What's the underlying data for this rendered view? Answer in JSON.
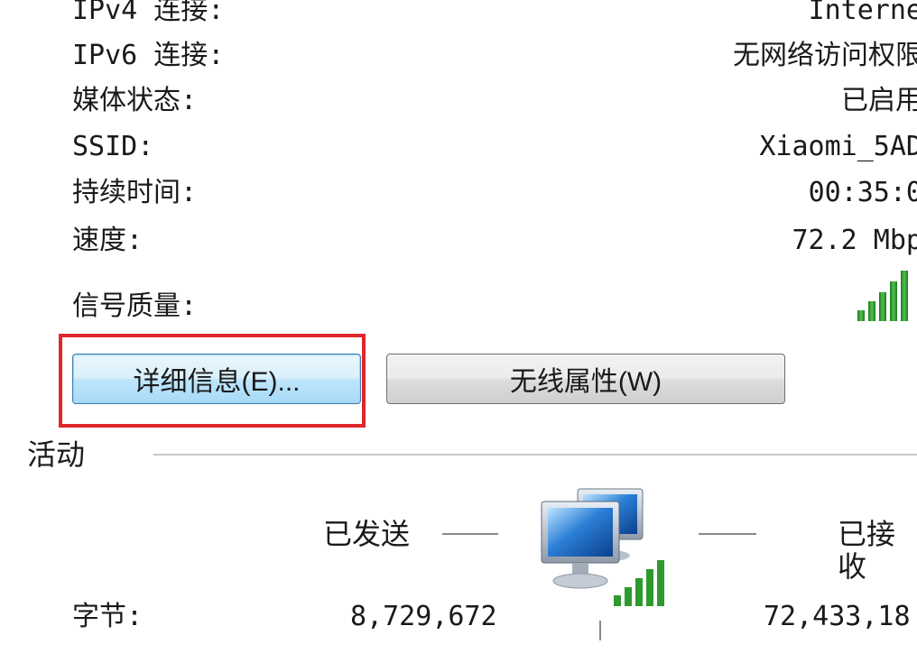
{
  "connection": {
    "rows": [
      {
        "label": "IPv4 连接:",
        "value": "Interne"
      },
      {
        "label": "IPv6 连接:",
        "value": "无网络访问权限"
      },
      {
        "label": "媒体状态:",
        "value": "已启用"
      },
      {
        "label": "SSID:",
        "value": "Xiaomi_5AD"
      },
      {
        "label": "持续时间:",
        "value": "00:35:0"
      },
      {
        "label": "速度:",
        "value": "72.2 Mbp"
      }
    ],
    "signal_label": "信号质量:",
    "signal_bars": 5,
    "signal_icon": "signal-strength-icon"
  },
  "buttons": {
    "details": "详细信息(E)...",
    "wireless": "无线属性(W)"
  },
  "activity": {
    "title": "活动",
    "sent_label": "已发送",
    "received_label": "已接收",
    "bytes_label": "字节:",
    "bytes_sent": "8,729,672",
    "bytes_received": "72,433,18",
    "network_icon": "network-computers-icon"
  },
  "colors": {
    "highlight": "#e0262b",
    "signal_green": "#3aa53a",
    "focus_blue": "#3c7fb1"
  }
}
